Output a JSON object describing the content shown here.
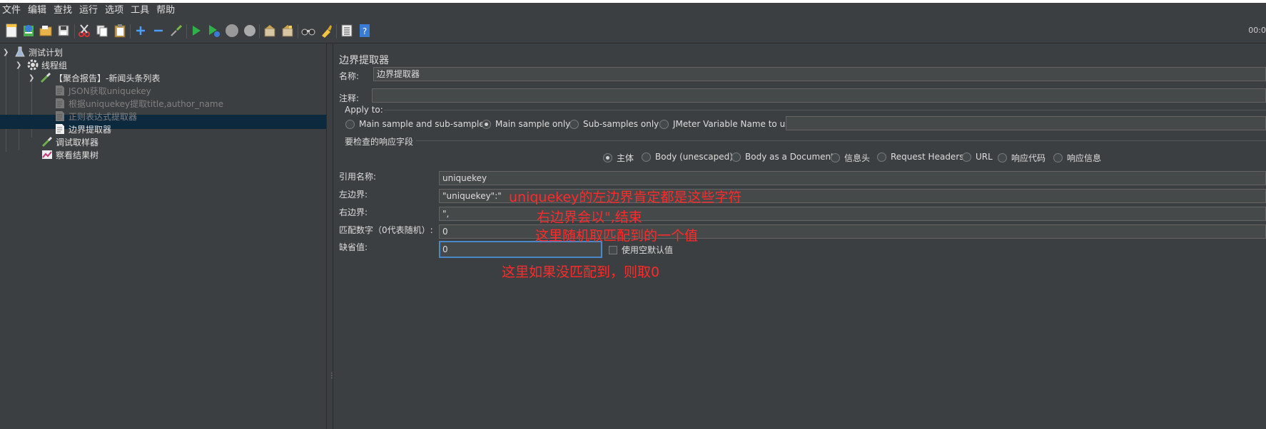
{
  "menu": [
    "文件",
    "编辑",
    "查找",
    "运行",
    "选项",
    "工具",
    "帮助"
  ],
  "toolbar": {
    "timer": "00:0"
  },
  "tree": {
    "plan": "测试计划",
    "thread_group": "线程组",
    "sampler": "【聚合报告】-新闻头条列表",
    "json_extractor": "JSON获取uniquekey",
    "json_extractor2": "根据uniquekey提取title,author_name",
    "regex_extractor": "正则表达式提取器",
    "boundary_extractor": "边界提取器",
    "debug_sampler": "调试取样器",
    "result_tree": "察看结果树"
  },
  "form": {
    "title": "边界提取器",
    "name_label": "名称:",
    "name_value": "边界提取器",
    "comment_label": "注释:",
    "comment_value": "",
    "apply_to_label": "Apply to:",
    "apply_options": [
      "Main sample and sub-samples",
      "Main sample only",
      "Sub-samples only",
      "JMeter Variable Name to use"
    ],
    "apply_selected": 1,
    "field_group_label": "要检查的响应字段",
    "field_options": [
      "主体",
      "Body (unescaped)",
      "Body as a Document",
      "信息头",
      "Request Headers",
      "URL",
      "响应代码",
      "响应信息"
    ],
    "field_selected": 0,
    "ref_name_label": "引用名称:",
    "ref_name_value": "uniquekey",
    "left_label": "左边界:",
    "left_value": "\"uniquekey\":\"",
    "right_label": "右边界:",
    "right_value": "\",",
    "match_label": "匹配数字（0代表随机）:",
    "match_value": "0",
    "default_label": "缺省值:",
    "default_value": "0",
    "empty_default_label": "使用空默认值"
  },
  "annotations": {
    "left": "uniquekey的左边界肯定都是这些字符",
    "right": "右边界会以\",结束",
    "match": "这里随机取匹配到的一个值",
    "default": "这里如果没匹配到，则取0"
  },
  "colors": {
    "annotation": "#ff2a2a",
    "selection": "#0d293e",
    "focus": "#4a88c7"
  }
}
